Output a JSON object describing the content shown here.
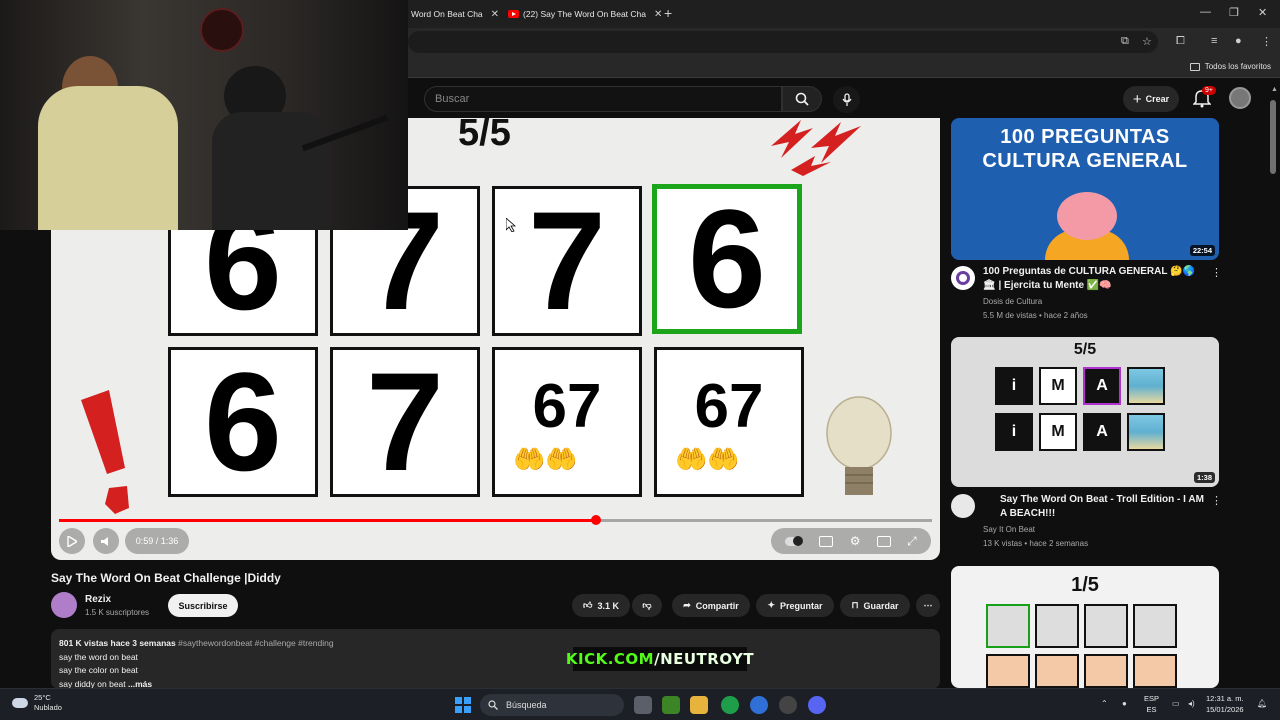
{
  "browser": {
    "tabs": [
      {
        "title": "Word On Beat Cha",
        "active": false
      },
      {
        "title": "(22) Say The Word On Beat Cha",
        "active": true
      }
    ],
    "bookmarks_folder": "Todos los favoritos"
  },
  "youtube": {
    "search_placeholder": "Buscar",
    "create_label": "Crear",
    "notif_count": "9+"
  },
  "player": {
    "score": "5/5",
    "grid_top": [
      "6",
      "7",
      "7",
      "6"
    ],
    "grid_bottom": [
      "6",
      "7",
      "67",
      "67"
    ],
    "time": "0:59 / 1:36",
    "progress": 0.615
  },
  "video": {
    "title": "Say The Word On Beat Challenge |Diddy",
    "channel": "Rezix",
    "subscribers": "1.5 K suscriptores",
    "subscribe_label": "Suscribirse",
    "likes": "3.1 K",
    "share_label": "Compartir",
    "ask_label": "Preguntar",
    "save_label": "Guardar",
    "views_age": "801 K vistas  hace 3 semanas",
    "tags": "#saythewordonbeat #challenge #trending",
    "desc_lines": [
      "say the word on beat",
      "say the color on beat"
    ],
    "desc_last": "say diddy on beat",
    "desc_more": "...más"
  },
  "overlay": {
    "kick_prefix": "KICK.COM",
    "kick_suffix": "/NEUTROYT"
  },
  "recommendations": [
    {
      "thumb_line1": "100 PREGUNTAS",
      "thumb_line2": "CULTURA GENERAL",
      "duration": "22:54",
      "title": "100 Preguntas de CULTURA GENERAL 🤔🌎 🏛 | Ejercita tu Mente ✅🧠",
      "channel": "Dosis de Cultura",
      "meta": "5.5 M de vistas • hace 2 años"
    },
    {
      "thumb_score": "5/5",
      "thumb_tiles": [
        "i",
        "M",
        "A"
      ],
      "duration": "1:38",
      "title": "Say The Word On Beat - Troll Edition - I AM A BEACH!!!",
      "channel": "Say It On Beat",
      "meta": "13 K vistas • hace 2 semanas"
    },
    {
      "thumb_score": "1/5"
    }
  ],
  "taskbar": {
    "temp": "25°C",
    "weather": "Nublado",
    "search": "Búsqueda",
    "lang1": "ESP",
    "lang2": "ES",
    "time": "12:31 a. m.",
    "date": "15/01/2026"
  }
}
